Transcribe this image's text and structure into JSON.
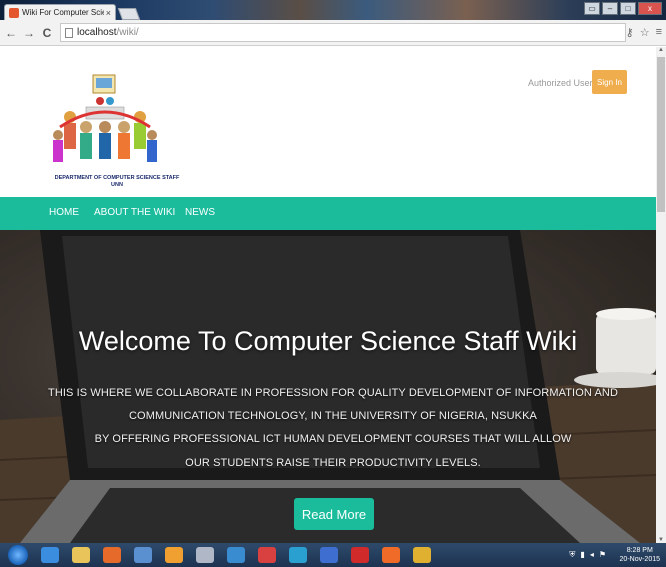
{
  "browser": {
    "tab_title": "Wiki For Computer Scienc",
    "tab_close": "×",
    "url_host": "localhost",
    "url_path": "/wiki/"
  },
  "window_controls": {
    "minimize": "▭",
    "restore": "–",
    "maximize": "□",
    "close": "x"
  },
  "header": {
    "department_line1": "DEPARTMENT OF COMPUTER SCIENCE STAFF",
    "department_line2": "UNN",
    "auth_text": "Authorized User",
    "signin_label": "Sign In"
  },
  "nav": {
    "items": [
      {
        "label": "HOME"
      },
      {
        "label": "ABOUT THE WIKI"
      },
      {
        "label": "NEWS"
      }
    ]
  },
  "hero": {
    "title": "Welcome To Computer Science Staff Wiki",
    "lines": [
      "THIS IS WHERE WE COLLABORATE IN PROFESSION FOR QUALITY DEVELOPMENT OF INFORMATION AND",
      "COMMUNICATION TECHNOLOGY, IN THE UNIVERSITY OF NIGERIA, NSUKKA",
      "BY OFFERING PROFESSIONAL ICT HUMAN DEVELOPMENT COURSES THAT WILL ALLOW",
      "OUR STUDENTS RAISE THEIR PRODUCTIVITY LEVELS."
    ],
    "button_label": "Read More"
  },
  "taskbar": {
    "time": "8:28 PM",
    "date": "20-Nov-2015"
  },
  "colors": {
    "accent": "#1abc9c",
    "signin": "#f0ad4e"
  },
  "icons": [
    "back-icon",
    "forward-icon",
    "reload-icon",
    "page-icon",
    "key-icon",
    "star-icon",
    "menu-icon"
  ]
}
